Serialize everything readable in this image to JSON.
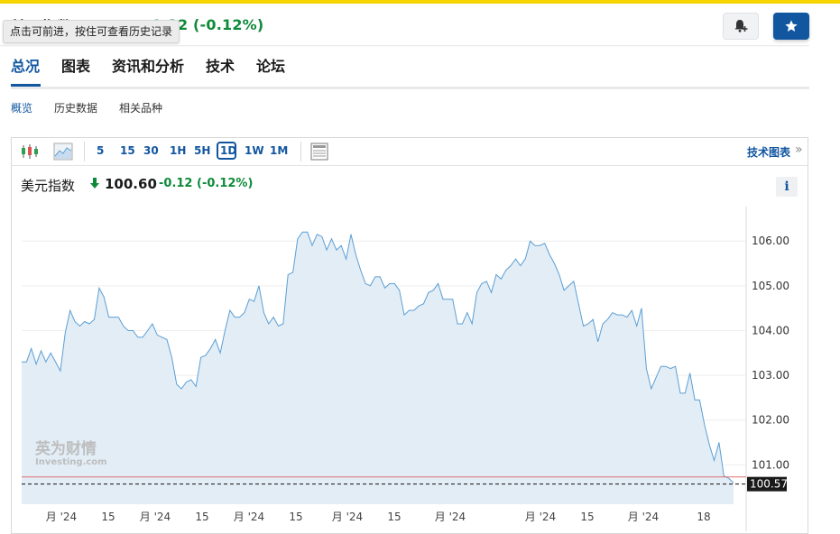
{
  "header": {
    "title": "美元指数",
    "change_text": "0.12  (-0.12%)",
    "tooltip": "点击可前进，按住可查看历史记录"
  },
  "tabs": [
    {
      "label": "总况",
      "active": true
    },
    {
      "label": "图表",
      "active": false
    },
    {
      "label": "资讯和分析",
      "active": false
    },
    {
      "label": "技术",
      "active": false
    },
    {
      "label": "论坛",
      "active": false
    }
  ],
  "subtabs": [
    {
      "label": "概览",
      "active": true
    },
    {
      "label": "历史数据",
      "active": false
    },
    {
      "label": "相关品种",
      "active": false
    }
  ],
  "toolbar": {
    "intervals": [
      "5",
      "15",
      "30",
      "1H",
      "5H",
      "1D",
      "1W",
      "1M"
    ],
    "selected_interval": "1D",
    "tech_chart_label": "技术图表",
    "tech_chart_arrow": "»"
  },
  "quote": {
    "name": "美元指数",
    "price": "100.60",
    "change": "-0.12",
    "change_pct": "(-0.12%)",
    "direction_icon": "down-arrow-icon",
    "info_label": "i"
  },
  "watermark": {
    "brand": "英为财情",
    "sub": "Investing.com"
  },
  "colors": {
    "accent": "#1256a0",
    "positive": "#0f8a3a",
    "line": "#5b9fd4",
    "area": "#e3edf6",
    "ref_line": "#e07070"
  },
  "chart_data": {
    "type": "area",
    "y_ticks": [
      "106.00",
      "105.00",
      "104.00",
      "103.00",
      "102.00",
      "101.00"
    ],
    "ylim": [
      100.12,
      106.77
    ],
    "x_ticks": [
      "月 '24",
      "15",
      "月 '24",
      "15",
      "月 '24",
      "15",
      "月 '24",
      "15",
      "月 '24",
      "月 '24",
      "15",
      "月 '24",
      "18"
    ],
    "current_value_label": "100.57",
    "current_value": 100.57,
    "reference_value": 100.73,
    "values": [
      103.3,
      103.3,
      103.6,
      103.25,
      103.55,
      103.3,
      103.5,
      103.3,
      103.1,
      103.95,
      104.45,
      104.2,
      104.1,
      104.2,
      104.15,
      104.25,
      104.95,
      104.75,
      104.3,
      104.3,
      104.3,
      104.1,
      104.0,
      104.0,
      103.85,
      103.85,
      104.0,
      104.15,
      103.9,
      103.85,
      103.8,
      103.4,
      102.8,
      102.7,
      102.85,
      102.9,
      102.75,
      103.4,
      103.45,
      103.6,
      103.8,
      103.5,
      104.0,
      104.45,
      104.3,
      104.3,
      104.4,
      104.7,
      104.65,
      105.0,
      104.4,
      104.15,
      104.3,
      104.1,
      104.15,
      105.25,
      105.3,
      106.05,
      106.2,
      106.2,
      105.9,
      106.15,
      106.1,
      105.8,
      106.05,
      105.8,
      105.9,
      105.6,
      106.15,
      105.7,
      105.35,
      105.05,
      105.0,
      105.2,
      105.2,
      104.95,
      105.05,
      105.05,
      104.9,
      104.35,
      104.45,
      104.45,
      104.55,
      104.6,
      104.85,
      104.9,
      105.05,
      104.7,
      104.7,
      104.7,
      104.15,
      104.15,
      104.4,
      104.15,
      104.85,
      105.05,
      105.1,
      104.85,
      105.25,
      105.15,
      105.35,
      105.45,
      105.6,
      105.45,
      105.6,
      106.0,
      105.9,
      105.9,
      105.95,
      105.7,
      105.5,
      105.25,
      104.9,
      105.0,
      105.1,
      104.6,
      104.1,
      104.15,
      104.25,
      103.75,
      104.15,
      104.25,
      104.4,
      104.35,
      104.35,
      104.3,
      104.45,
      104.1,
      104.5,
      103.15,
      102.7,
      102.95,
      103.2,
      103.2,
      103.15,
      103.2,
      102.6,
      102.6,
      103.05,
      102.45,
      102.45,
      101.9,
      101.45,
      101.1,
      101.5,
      100.75,
      100.7,
      100.6
    ]
  }
}
